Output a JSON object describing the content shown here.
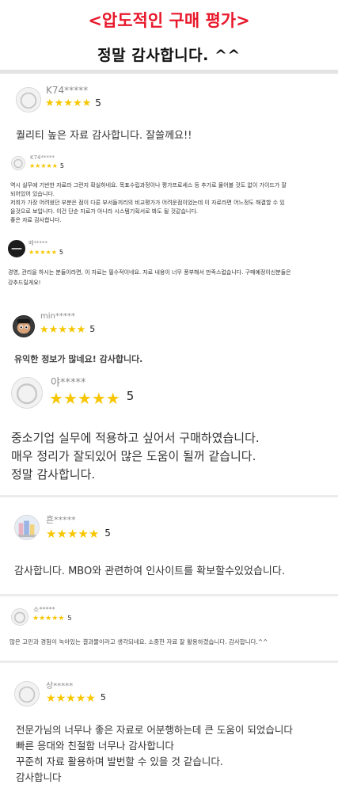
{
  "header": {
    "title": "<압도적인 구매 평가>",
    "subtitle": "정말 감사합니다. ^^"
  },
  "colors": {
    "title_red": "#e8182b",
    "star_yellow": "#f7c600",
    "divider_gray": "#e3e3e3"
  },
  "reviews": [
    {
      "user": "K74*****",
      "rating": 5,
      "rating_label": "5",
      "avatar_icon": "default-user-icon",
      "lines": [
        "퀄리티 높은 자료 감사합니다. 잘쓸께요!!"
      ]
    },
    {
      "user": "K74*****",
      "rating": 5,
      "rating_label": "5",
      "avatar_icon": "default-user-icon",
      "lines": [
        "역시 실무에 기반한 자료라 그런지 확실하네요. 목표수립과정이나 평가프로세스 등 추가로 물어볼 것도 없이 가이드가 잘",
        "되어있어 있습니다.",
        "저희가 가장 어려웠던 부분은 점이 다른 부서들끼리의 비교평가가 어려운점이었는데 이 자료라면 어느정도 해결할 수 있",
        "을것으로 보입니다. 이건 단순 자료가 아니라 시스템기획서로 봐도 될 것같습니다.",
        "좋은 자료 감사합니다."
      ]
    },
    {
      "user": "베*****",
      "rating": 5,
      "rating_label": "5",
      "avatar_icon": "logo-avatar-icon",
      "lines": [
        "경영, 관리을 하시는 분들이라면, 이 자료는 필수적이네요. 자료 내용이 너무 풍부해서 만족스럽습니다. 구매예정이신분들은",
        "강추드릴게요!"
      ]
    },
    {
      "user": "min*****",
      "rating": 5,
      "rating_label": "5",
      "avatar_icon": "cartoon-avatar-icon",
      "lines": [
        "유익한 정보가 많네요! 감사합니다."
      ]
    },
    {
      "user": "야*****",
      "rating": 5,
      "rating_label": "5",
      "avatar_icon": "default-user-icon",
      "lines": [
        "중소기업 실무에 적용하고 싶어서 구매하였습니다.",
        "매우 정리가 잘되있어 많은 도움이 될꺼 같습니다.",
        "정말 감사합니다."
      ]
    },
    {
      "user": "흔*****",
      "rating": 5,
      "rating_label": "5",
      "avatar_icon": "photo-avatar-icon",
      "lines": [
        "감사합니다. MBO와 관련하여 인사이트를 확보할수있었습니다."
      ]
    },
    {
      "user": "소*****",
      "rating": 5,
      "rating_label": "5",
      "avatar_icon": "default-user-icon",
      "lines": [
        "많은 고민과 경험이 녹아있는 결과물이라고 생각되네요. 소중한 자료 잘 활용하겠습니다. 감사합니다.^^"
      ]
    },
    {
      "user": "상*****",
      "rating": 5,
      "rating_label": "5",
      "avatar_icon": "default-user-icon",
      "lines": [
        "전문가님의 너무나 좋은 자료로 어분행하는데 큰 도움이 되었습니다",
        "빠른 응대와 친절함 너무나 감사합니다",
        "꾸준히 자료 활용하며 발번할 수 있을 것 같습니다.",
        "감사합니다"
      ]
    }
  ]
}
